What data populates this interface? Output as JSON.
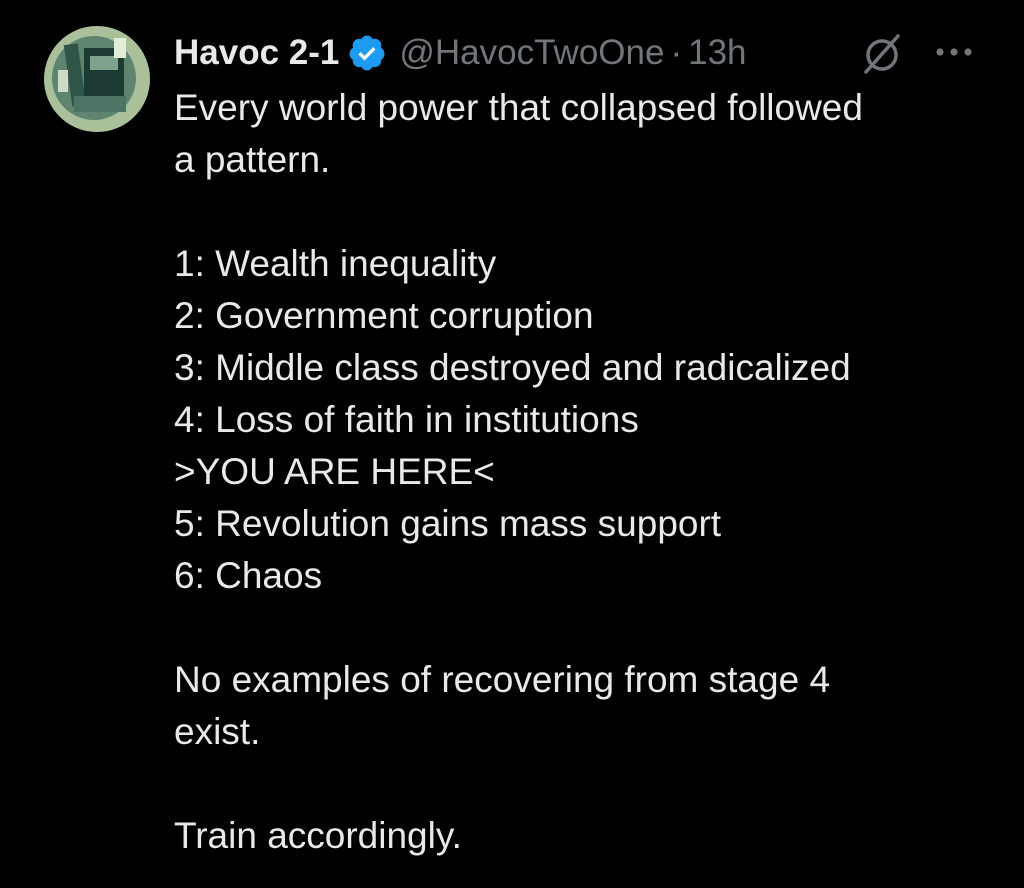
{
  "author": {
    "display_name": "Havoc 2-1",
    "handle": "@HavocTwoOne",
    "separator": "·",
    "timestamp": "13h",
    "verified_color": "#1d9bf0"
  },
  "icons": {
    "verified": "verified-badge-icon",
    "grok": "grok-icon",
    "more": "more-options-icon"
  },
  "tweet": {
    "intro_line1": "Every world power that collapsed followed",
    "intro_line2": "a pattern.",
    "list": [
      "1: Wealth inequality",
      "2: Government corruption",
      "3: Middle class destroyed and radicalized",
      "4: Loss of faith in institutions",
      ">YOU ARE HERE<",
      "5: Revolution gains mass support",
      "6: Chaos"
    ],
    "conclusion_line1": "No examples of recovering from stage 4",
    "conclusion_line2": "exist.",
    "closing": "Train accordingly."
  },
  "colors": {
    "background": "#000000",
    "text": "#e7e9ea",
    "muted": "#71767b"
  }
}
